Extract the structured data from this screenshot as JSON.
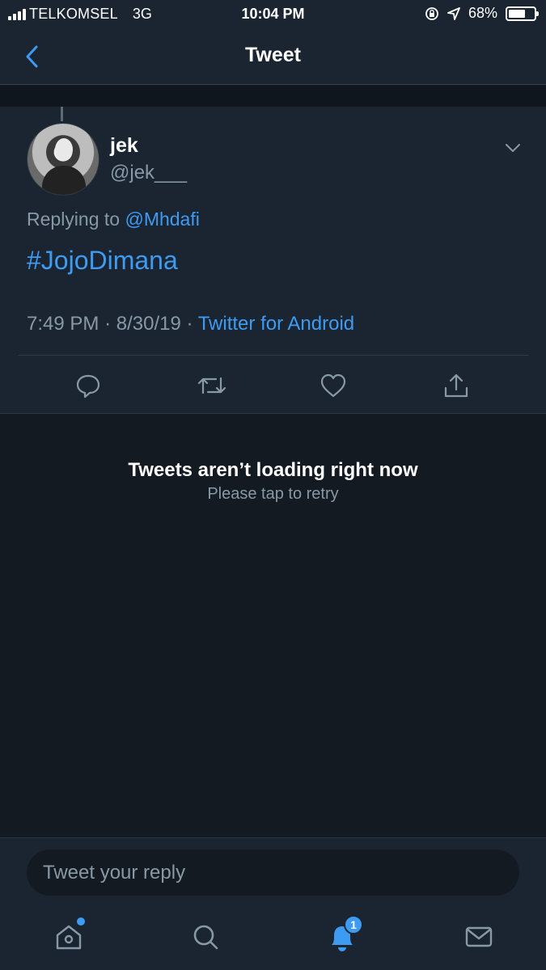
{
  "status_bar": {
    "carrier": "TELKOMSEL",
    "network": "3G",
    "time": "10:04 PM",
    "battery_percent": "68%",
    "battery_level": 0.68
  },
  "nav": {
    "title": "Tweet"
  },
  "tweet": {
    "display_name": "jek",
    "handle": "@jek___",
    "replying_prefix": "Replying to",
    "replying_to": "@Mhdafi",
    "text": "#JojoDimana",
    "time": "7:49 PM",
    "date": "8/30/19",
    "separator": "·",
    "source": "Twitter for Android"
  },
  "error": {
    "title": "Tweets aren’t loading right now",
    "subtitle": "Please tap to retry"
  },
  "reply": {
    "placeholder": "Tweet your reply"
  },
  "tabs": {
    "notifications_badge": "1"
  },
  "colors": {
    "accent": "#3e9bf2",
    "background": "#141a22",
    "surface": "#1b2532",
    "secondary_text": "#8899a6"
  }
}
